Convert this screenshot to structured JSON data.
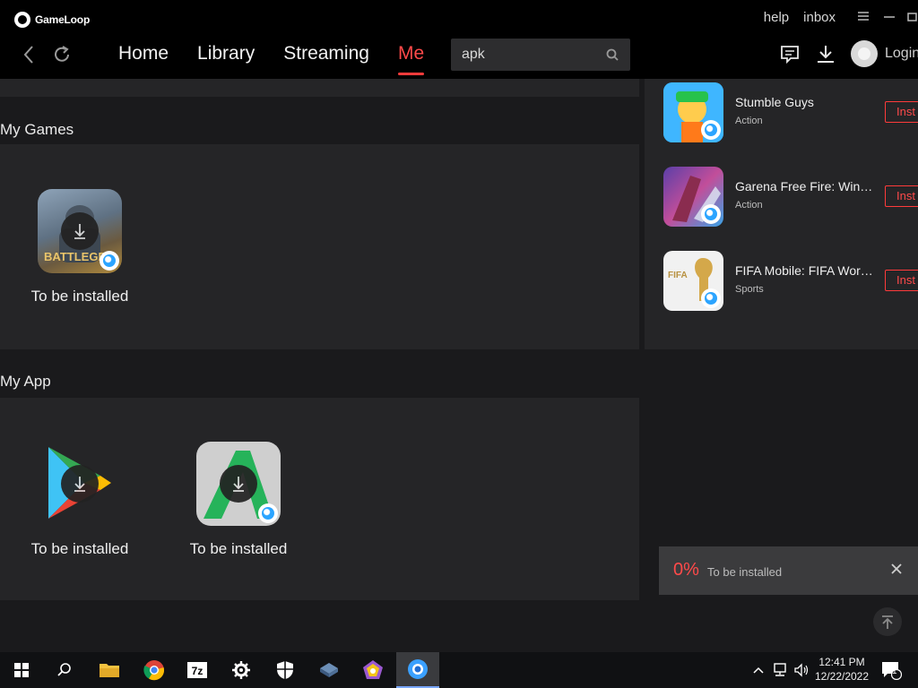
{
  "app": {
    "logo_text": "GameLoop",
    "help_label": "help",
    "inbox_label": "inbox"
  },
  "nav": {
    "tabs": [
      {
        "label": "Home",
        "active": false
      },
      {
        "label": "Library",
        "active": false
      },
      {
        "label": "Streaming",
        "active": false
      },
      {
        "label": "Me",
        "active": true
      }
    ],
    "search_value": "apk",
    "login_label": "Login"
  },
  "my_games": {
    "title": "My Games",
    "items": [
      {
        "label": "To be installed",
        "icon": "battlegrounds-icon"
      }
    ]
  },
  "my_app": {
    "title": "My App",
    "items": [
      {
        "label": "To be installed",
        "icon": "google-play-icon"
      },
      {
        "label": "To be installed",
        "icon": "apkpure-icon"
      }
    ]
  },
  "recommendations": [
    {
      "name": "Stumble Guys",
      "category": "Action",
      "button": "Inst"
    },
    {
      "name": "Garena Free Fire: Win…",
      "category": "Action",
      "button": "Inst"
    },
    {
      "name": "FIFA Mobile: FIFA Wor…",
      "category": "Sports",
      "button": "Inst"
    }
  ],
  "toast": {
    "percent": "0%",
    "status": "To be installed"
  },
  "taskbar": {
    "time": "12:41 PM",
    "date": "12/22/2022",
    "notifications": "1"
  },
  "colors": {
    "accent": "#ff3b3b",
    "topbar": "#000000",
    "panel": "#252527",
    "background": "#1a1a1c"
  }
}
